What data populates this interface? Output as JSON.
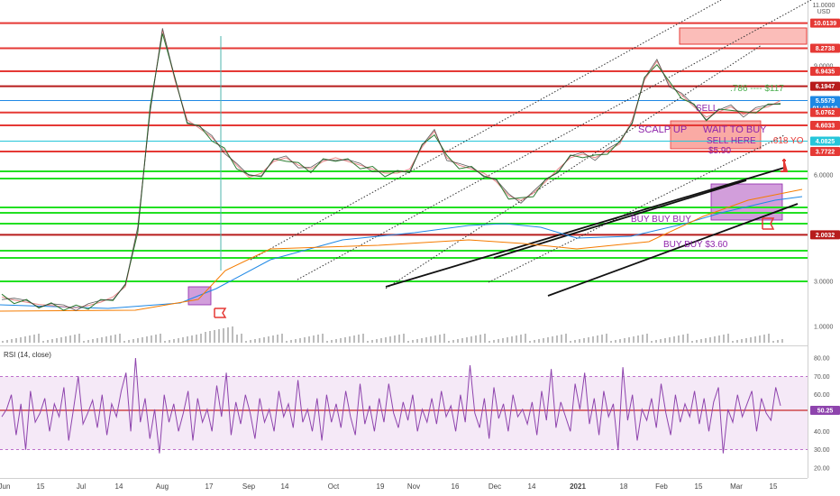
{
  "header": {
    "currency_top": "11.0000",
    "currency_unit": "USD"
  },
  "chart_data": [
    {
      "type": "line",
      "title": "",
      "scale": "log",
      "ylim": [
        0.9,
        12
      ],
      "x_labels": [
        "Jun",
        "15",
        "Jul",
        "14",
        "Aug",
        "17",
        "Sep",
        "14",
        "Oct",
        "19",
        "Nov",
        "16",
        "Dec",
        "14",
        "2021",
        "18",
        "Feb",
        "15",
        "Mar",
        "15"
      ],
      "y_ticks": [
        "9.0000",
        "6.0000",
        "3.0000",
        "1.0000"
      ],
      "horizontal_levels": [
        {
          "value": "10.0139",
          "color": "#e53935"
        },
        {
          "value": "8.2738",
          "color": "#e53935"
        },
        {
          "value": "6.9435",
          "color": "#e53935"
        },
        {
          "value": "6.1947",
          "color": "#b71c1c"
        },
        {
          "value": "5.5579",
          "color": "#1e88e5",
          "sub": "01:49:19"
        },
        {
          "value": "5.0762",
          "color": "#e53935"
        },
        {
          "value": "4.6033",
          "color": "#e53935"
        },
        {
          "value": "4.0825",
          "color": "#26c6da"
        },
        {
          "value": "3.7722",
          "color": "#e53935"
        },
        {
          "value": "2.0032",
          "color": "#b71c1c"
        }
      ],
      "annotations": [
        ".786 ---- $117",
        "SELL",
        "SCALP UP",
        "WAIT TO BUY",
        "SELL HERE",
        ".618 YO",
        "BUY BUY BUY",
        "BUY BUY $3.60"
      ],
      "price_series": [
        1.25,
        1.22,
        1.2,
        1.18,
        1.17,
        1.16,
        1.15,
        1.17,
        1.2,
        1.25,
        1.35,
        2.1,
        5.2,
        9.5,
        6.5,
        4.8,
        4.5,
        4.2,
        3.8,
        3.4,
        3.1,
        3.2,
        3.5,
        3.6,
        3.4,
        3.3,
        3.5,
        3.6,
        3.5,
        3.4,
        3.3,
        3.2,
        3.2,
        3.3,
        3.9,
        4.4,
        3.6,
        3.4,
        3.3,
        3.2,
        3.0,
        2.7,
        2.6,
        2.75,
        3.0,
        3.3,
        3.6,
        3.7,
        3.6,
        3.8,
        4.0,
        4.8,
        6.5,
        7.5,
        6.3,
        5.8,
        5.3,
        4.9,
        5.1,
        5.3,
        5.0,
        5.2,
        5.3,
        5.56
      ]
    },
    {
      "type": "line",
      "title": "RSI (14, close)",
      "ylim": [
        15,
        85
      ],
      "y_ticks": [
        "80.00",
        "70.00",
        "60.00",
        "40.00",
        "30.00",
        "20.00"
      ],
      "current_value": "50.25",
      "band": [
        30,
        70
      ],
      "rsi_series": [
        48,
        52,
        60,
        38,
        55,
        30,
        62,
        45,
        50,
        58,
        40,
        55,
        48,
        64,
        35,
        52,
        70,
        44,
        50,
        57,
        42,
        60,
        38,
        55,
        48,
        62,
        72,
        40,
        80,
        45,
        58,
        36,
        52,
        28,
        60,
        45,
        55,
        40,
        50,
        62,
        35,
        58,
        45,
        52,
        40,
        65,
        48,
        72,
        38,
        56,
        44,
        60,
        50,
        36,
        58,
        45,
        52,
        40,
        62,
        48,
        55,
        42,
        68,
        45,
        52,
        40,
        58,
        35,
        60,
        45,
        55,
        42,
        62,
        48,
        38,
        66,
        44,
        54,
        40,
        58,
        45,
        66,
        50,
        42,
        56,
        46,
        60,
        40,
        52,
        45,
        58,
        44,
        62,
        48,
        54,
        40,
        60,
        45,
        76,
        50,
        42,
        58,
        36,
        64,
        47,
        55,
        40,
        60,
        48,
        52,
        44,
        56,
        38,
        62,
        46,
        74,
        42,
        56,
        48,
        40,
        66,
        52,
        72,
        44,
        58,
        38,
        62,
        48,
        55,
        30,
        75,
        46,
        60,
        35,
        52,
        46,
        58,
        42,
        66,
        50,
        38,
        60,
        45,
        55,
        48,
        62,
        44,
        58,
        40,
        56,
        64,
        28,
        52,
        45,
        60,
        48,
        55,
        62,
        40,
        58,
        50,
        46,
        64,
        54
      ]
    }
  ]
}
